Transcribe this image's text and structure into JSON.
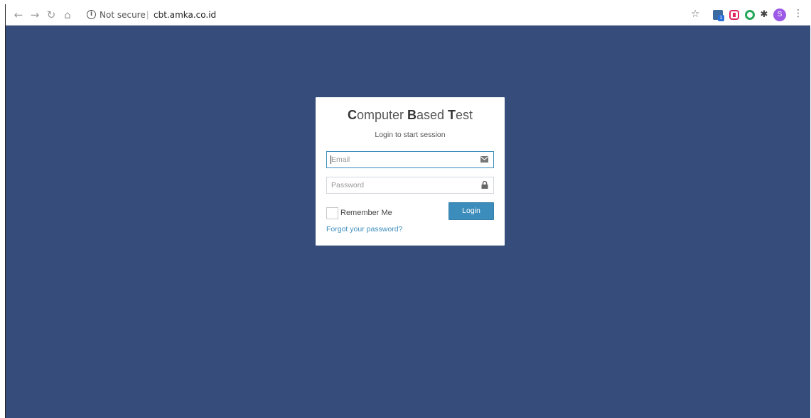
{
  "browser": {
    "security_label": "Not secure",
    "separator": "|",
    "url": "cbt.amka.co.id",
    "avatar_initial": "S",
    "extension_badge": "1",
    "nav_icons": [
      "back-arrow-icon",
      "forward-arrow-icon",
      "reload-icon",
      "home-icon"
    ],
    "extension_icons": [
      "extension-icon",
      "youtube-extension-icon",
      "green-circle-extension-icon",
      "puzzle-extensions-icon"
    ]
  },
  "login": {
    "title_parts": [
      {
        "strong": "C",
        "rest": "omputer "
      },
      {
        "strong": "B",
        "rest": "ased "
      },
      {
        "strong": "T",
        "rest": "est"
      }
    ],
    "subtitle": "Login to start session",
    "email_placeholder": "Email",
    "password_placeholder": "Password",
    "remember_label": "Remember Me",
    "login_button": "Login",
    "forgot_link": "Forgot your password?"
  },
  "colors": {
    "page_background": "#364d7b",
    "accent": "#3c8dbc",
    "card_background": "#ffffff"
  }
}
